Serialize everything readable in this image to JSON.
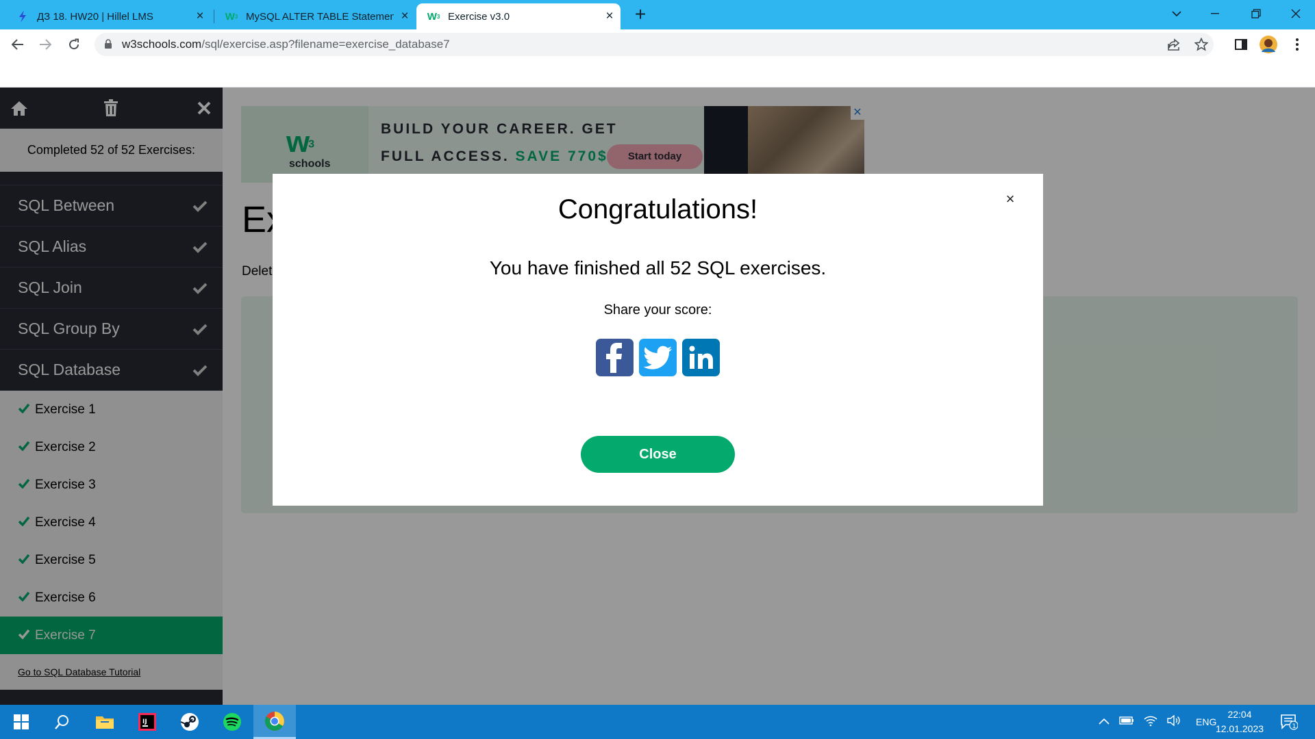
{
  "browser": {
    "tabs": [
      {
        "title": "ДЗ 18. HW20 | Hillel LMS",
        "favicon": "hillel-icon",
        "active": false
      },
      {
        "title": "MySQL ALTER TABLE Statement",
        "favicon": "w3schools-icon",
        "active": false
      },
      {
        "title": "Exercise v3.0",
        "favicon": "w3schools-icon",
        "active": true
      }
    ],
    "url_host": "w3schools.com",
    "url_path": "/sql/exercise.asp?filename=exercise_database7"
  },
  "sidebar": {
    "status": "Completed 52 of 52 Exercises:",
    "sections": [
      {
        "label": "SQL Between",
        "done": true
      },
      {
        "label": "SQL Alias",
        "done": true
      },
      {
        "label": "SQL Join",
        "done": true
      },
      {
        "label": "SQL Group By",
        "done": true
      },
      {
        "label": "SQL Database",
        "done": true
      }
    ],
    "exercises": [
      {
        "label": "Exercise 1",
        "done": true
      },
      {
        "label": "Exercise 2",
        "done": true
      },
      {
        "label": "Exercise 3",
        "done": true
      },
      {
        "label": "Exercise 4",
        "done": true
      },
      {
        "label": "Exercise 5",
        "done": true
      },
      {
        "label": "Exercise 6",
        "done": true
      },
      {
        "label": "Exercise 7",
        "done": true,
        "active": true
      }
    ],
    "tutorial_link": "Go to SQL Database Tutorial"
  },
  "ad": {
    "logo_main": "w",
    "logo_sup": "3",
    "logo_sub": "schools",
    "line1": "BUILD YOUR CAREER. GET",
    "line2_a": "FULL ACCESS.",
    "line2_b": "SAVE 770$",
    "cta": "Start today"
  },
  "main": {
    "title_partial": "Ex",
    "instruction_partial": "Delet"
  },
  "modal": {
    "title": "Congratulations!",
    "message": "You have finished all 52 SQL exercises.",
    "share_label": "Share your score:",
    "share_buttons": [
      "facebook-icon",
      "twitter-icon",
      "linkedin-icon"
    ],
    "close_label": "Close"
  },
  "taskbar": {
    "language": "ENG",
    "time": "22:04",
    "date": "12.01.2023",
    "notification_count": "1"
  },
  "colors": {
    "w3_green": "#04aa6d",
    "sidebar_dark": "#282a35",
    "chrome_tabstrip": "#2fb6f1",
    "facebook": "#3b5998",
    "twitter": "#1da1f2",
    "linkedin": "#0077b5"
  }
}
